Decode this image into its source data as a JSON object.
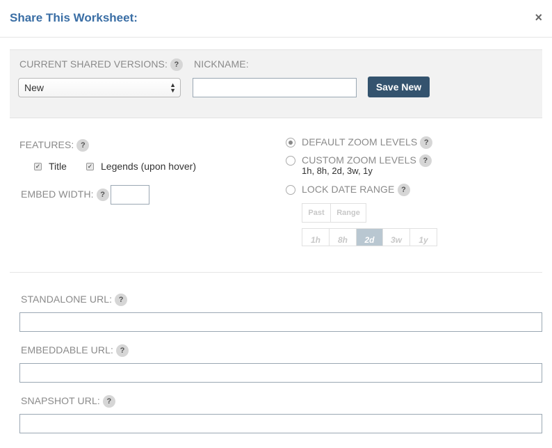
{
  "dialog": {
    "title": "Share This Worksheet:",
    "close_glyph": "×"
  },
  "versions": {
    "current_label": "CURRENT SHARED VERSIONS:",
    "selected": "New",
    "nickname_label": "NICKNAME:",
    "nickname_value": "",
    "save_label": "Save New"
  },
  "features": {
    "label": "FEATURES:",
    "items": [
      {
        "label": "Title",
        "checked": true
      },
      {
        "label": "Legends (upon hover)",
        "checked": true
      }
    ],
    "embed_width_label": "EMBED WIDTH:",
    "embed_width_value": ""
  },
  "zoom": {
    "options": [
      {
        "label": "DEFAULT ZOOM LEVELS",
        "checked": true
      },
      {
        "label": "CUSTOM ZOOM LEVELS",
        "checked": false
      },
      {
        "label": "LOCK DATE RANGE",
        "checked": false
      }
    ],
    "custom_values": "1h, 8h, 2d, 3w, 1y",
    "mode_tabs": [
      "Past",
      "Range"
    ],
    "ranges": [
      "1h",
      "8h",
      "2d",
      "3w",
      "1y"
    ],
    "active_range": "2d"
  },
  "urls": {
    "standalone_label": "STANDALONE URL:",
    "embeddable_label": "EMBEDDABLE URL:",
    "snapshot_label": "SNAPSHOT URL:"
  },
  "help_glyph": "?",
  "colors": {
    "title": "#3a6ea5",
    "button": "#34536e",
    "active_range": "#b9c7d1"
  }
}
